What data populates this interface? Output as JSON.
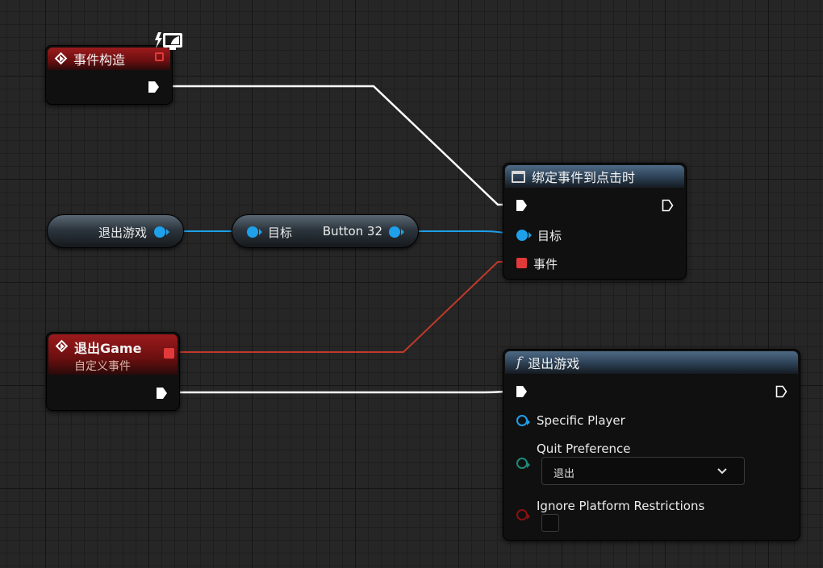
{
  "nodes": {
    "event_construct": {
      "title": "事件构造"
    },
    "quit_game_event": {
      "title": "退出Game",
      "subtitle": "自定义事件"
    },
    "quit_game_var": {
      "label": "退出游戏"
    },
    "target_get": {
      "target_label": "目标",
      "value_label": "Button 32"
    },
    "bind_event": {
      "title": "绑定事件到点击时",
      "target_label": "目标",
      "event_label": "事件"
    },
    "quit_game_func": {
      "title": "退出游戏",
      "specific_player_label": "Specific Player",
      "quit_preference_label": "Quit Preference",
      "quit_preference_value": "退出",
      "ignore_platform_label": "Ignore Platform Restrictions",
      "ignore_platform_checked": false
    }
  },
  "colors": {
    "event_header": "#9c1a1c",
    "func_header": "#4e6a86",
    "object_pin": "#1ea0ea",
    "delegate_pin": "#e23a3a",
    "exec_wire": "#ffffff",
    "delegate_wire": "#c0392b",
    "object_wire": "#1ea0ea"
  },
  "icons": {
    "event": "event-diamond-icon",
    "widget": "widget-window-icon",
    "function": "function-f-icon",
    "replication": "replication-monitor-icon",
    "dropdown": "chevron-down-icon"
  }
}
